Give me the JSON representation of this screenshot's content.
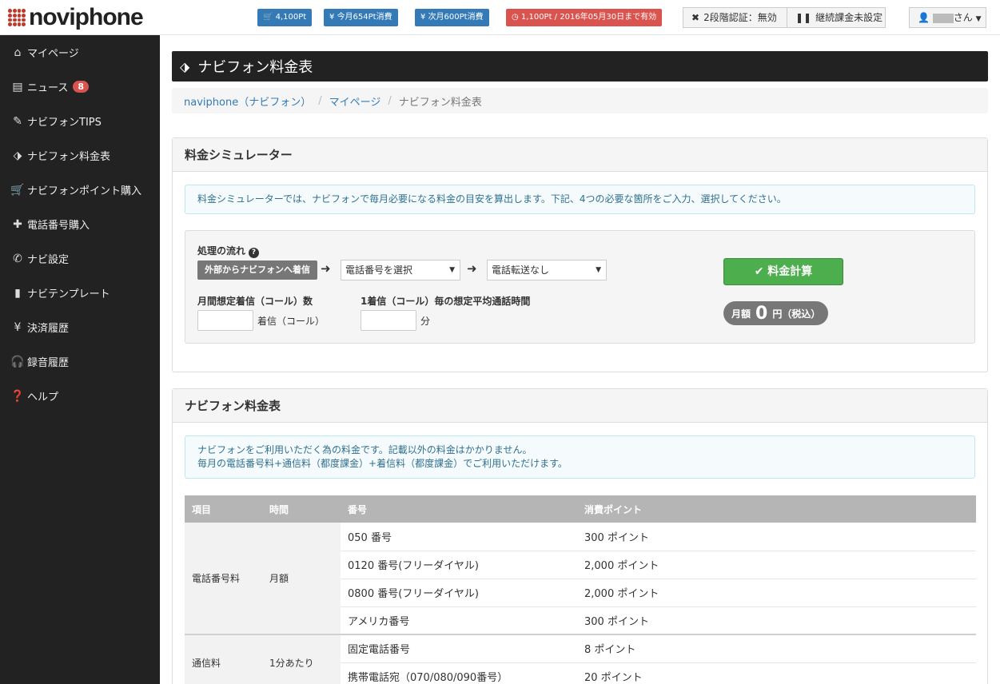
{
  "header": {
    "logo_text": "noviphone",
    "badges": {
      "points": "4,100Pt",
      "this_month": "今月654Pt消費",
      "next_month": "次月600Pt消費",
      "expiry": "1,100Pt / 2016年05月30日まで有効"
    },
    "two_factor": "2段階認証：無効",
    "billing": "継続課金未設定",
    "user_suffix": "さん"
  },
  "sidebar": {
    "items": [
      {
        "label": "マイページ",
        "icon": "home-icon"
      },
      {
        "label": "ニュース",
        "icon": "list-icon",
        "badge": "8"
      },
      {
        "label": "ナビフォンTIPS",
        "icon": "pencil-icon"
      },
      {
        "label": "ナビフォン料金表",
        "icon": "tag-icon"
      },
      {
        "label": "ナビフォンポイント購入",
        "icon": "cart-icon"
      },
      {
        "label": "電話番号購入",
        "icon": "plus-icon"
      },
      {
        "label": "ナビ設定",
        "icon": "phone-icon"
      },
      {
        "label": "ナビテンプレート",
        "icon": "file-icon"
      },
      {
        "label": "決済履歴",
        "icon": "yen-icon"
      },
      {
        "label": "録音履歴",
        "icon": "headphones-icon"
      },
      {
        "label": "ヘルプ",
        "icon": "question-icon"
      }
    ]
  },
  "page": {
    "title": "ナビフォン料金表",
    "breadcrumb": [
      "naviphone（ナビフォン）",
      "マイページ",
      "ナビフォン料金表"
    ]
  },
  "simulator": {
    "title": "料金シミュレーター",
    "info": "料金シミュレーターでは、ナビフォンで毎月必要になる料金の目安を算出します。下記、4つの必要な箇所をご入力、選択してください。",
    "flow_label": "処理の流れ",
    "step1": "外部からナビフォンへ着信",
    "select_number": "電話番号を選択",
    "select_forward": "電話転送なし",
    "calc_button": "料金計算",
    "calls_label": "月間想定着信（コール）数",
    "calls_unit": "着信（コール）",
    "duration_label": "1着信（コール）毎の想定平均通話時間",
    "duration_unit": "分",
    "total_prefix": "月額",
    "total_value": "0",
    "total_suffix": "円（税込）"
  },
  "pricing": {
    "title": "ナビフォン料金表",
    "info_line1": "ナビフォンをご利用いただく為の料金です。記載以外の料金はかかりません。",
    "info_line2": "毎月の電話番号料+通信料（都度課金）+着信料（都度課金）でご利用いただけます。",
    "columns": [
      "項目",
      "時間",
      "番号",
      "消費ポイント"
    ],
    "group1": {
      "item": "電話番号料",
      "time": "月額",
      "rows": [
        {
          "number": "050 番号",
          "points": "300 ポイント"
        },
        {
          "number": "0120 番号(フリーダイヤル)",
          "points": "2,000 ポイント"
        },
        {
          "number": "0800 番号(フリーダイヤル)",
          "points": "2,000 ポイント"
        },
        {
          "number": "アメリカ番号",
          "points": "300 ポイント"
        }
      ]
    },
    "group2": {
      "item": "通信料",
      "time": "1分あたり",
      "rows": [
        {
          "number": "固定電話番号",
          "points": "8 ポイント"
        },
        {
          "number": "携帯電話宛（070/080/090番号）",
          "points": "20 ポイント"
        }
      ]
    }
  }
}
